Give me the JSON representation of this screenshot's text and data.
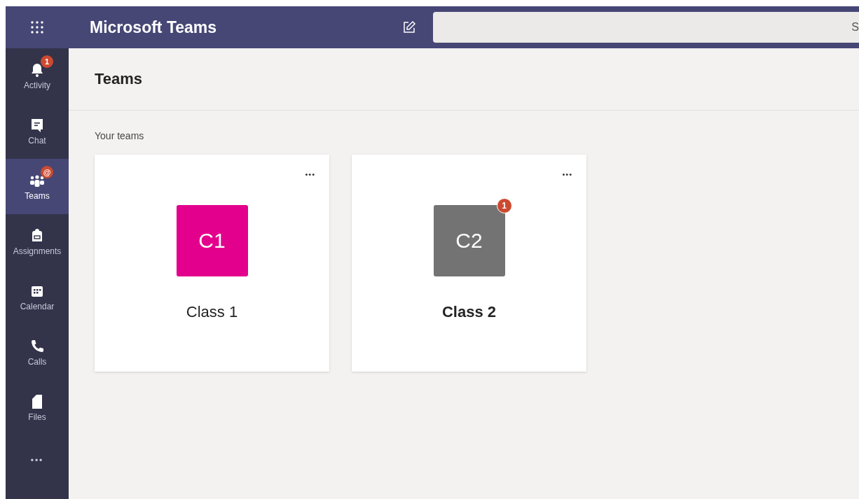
{
  "app_bar": {
    "title": "Microsoft Teams",
    "search": {
      "placeholder": "S"
    }
  },
  "sidebar": {
    "items": [
      {
        "label": "Activity",
        "kind": "bell",
        "badge": "1",
        "selected": false
      },
      {
        "label": "Chat",
        "kind": "chat",
        "selected": false
      },
      {
        "label": "Teams",
        "kind": "teams",
        "badge": "@",
        "selected": true
      },
      {
        "label": "Assignments",
        "kind": "bag",
        "selected": false
      },
      {
        "label": "Calendar",
        "kind": "calendar",
        "selected": false
      },
      {
        "label": "Calls",
        "kind": "phone",
        "selected": false
      },
      {
        "label": "Files",
        "kind": "file",
        "selected": false
      }
    ],
    "more": "•••"
  },
  "page": {
    "title": "Teams",
    "section": "Your teams",
    "teams": [
      {
        "name": "Class 1",
        "initials": "C1",
        "color": "#e3008c",
        "unread": false,
        "menu": "•••"
      },
      {
        "name": "Class 2",
        "initials": "C2",
        "color": "#737373",
        "unread": true,
        "badge": "1",
        "menu": "•••"
      }
    ]
  }
}
